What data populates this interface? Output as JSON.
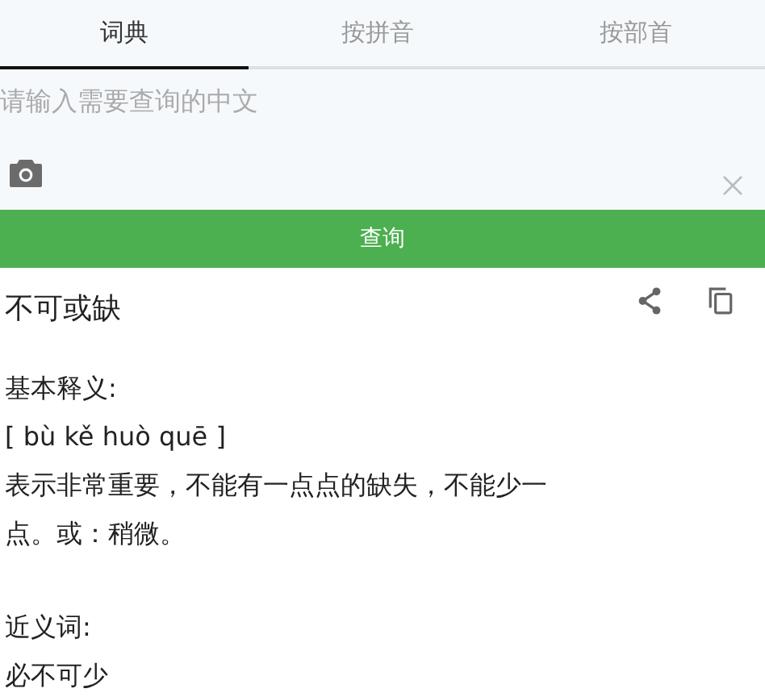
{
  "tabs": [
    {
      "label": "词典",
      "selected": true
    },
    {
      "label": "按拼音",
      "selected": false
    },
    {
      "label": "按部首",
      "selected": false
    }
  ],
  "search": {
    "placeholder": "请输入需要查询的中文"
  },
  "query_button": "查询",
  "result": {
    "word": "不可或缺",
    "sections": [
      {
        "heading": "基本释义:",
        "lines": [
          "[ bù kě huò quē ]",
          "表示非常重要，不能有一点点的缺失，不能少一点。或：稍微。"
        ]
      },
      {
        "heading": "近义词:",
        "lines": [
          "必不可少"
        ]
      }
    ]
  }
}
